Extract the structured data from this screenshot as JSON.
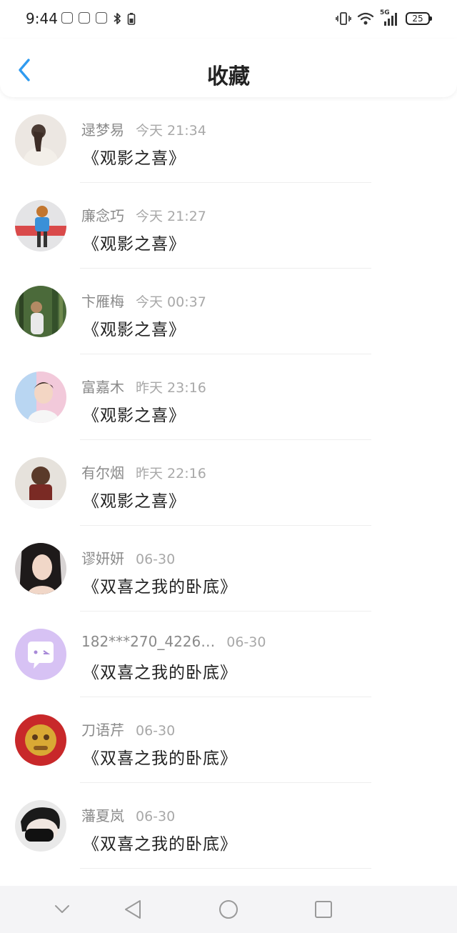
{
  "status_bar": {
    "time": "9:44",
    "battery": "25",
    "network": "5G",
    "icons": [
      "app-notification-icon",
      "app-notification-icon",
      "app-notification-icon",
      "bluetooth-icon",
      "vibrate-icon",
      "wifi-icon",
      "signal-icon",
      "battery-icon"
    ]
  },
  "header": {
    "title": "收藏",
    "back_icon": "chevron-left-icon"
  },
  "colors": {
    "accent": "#2f9bf0",
    "text_primary": "#222222",
    "text_secondary": "#8a8a8a",
    "divider": "#eeeeee",
    "nav_background": "#f4f4f6"
  },
  "favorites": [
    {
      "name": "逯梦易",
      "time": "今天 21:34",
      "title": "《观影之喜》",
      "avatar": "girl-back-portrait"
    },
    {
      "name": "廉念巧",
      "time": "今天 21:27",
      "title": "《观影之喜》",
      "avatar": "girl-blue-shirt"
    },
    {
      "name": "卞雁梅",
      "time": "今天 00:37",
      "title": "《观影之喜》",
      "avatar": "girl-forest"
    },
    {
      "name": "富嘉木",
      "time": "昨天 23:16",
      "title": "《观影之喜》",
      "avatar": "boy-portrait"
    },
    {
      "name": "有尔烟",
      "time": "昨天 22:16",
      "title": "《观影之喜》",
      "avatar": "girl-bob-hair"
    },
    {
      "name": "谬妍妍",
      "time": "06-30",
      "title": "《双喜之我的卧底》",
      "avatar": "girl-closeup"
    },
    {
      "name": "182***270_4226…",
      "time": "06-30",
      "title": "《双喜之我的卧底》",
      "avatar": "default-chat-avatar"
    },
    {
      "name": "刀语芹",
      "time": "06-30",
      "title": "《双喜之我的卧底》",
      "avatar": "golden-mask"
    },
    {
      "name": "藩夏岚",
      "time": "06-30",
      "title": "《双喜之我的卧底》",
      "avatar": "masked-person-bw"
    }
  ],
  "nav_bar": {
    "buttons": [
      "chevron-down-icon",
      "back-triangle-icon",
      "home-circle-icon",
      "recents-square-icon"
    ]
  }
}
